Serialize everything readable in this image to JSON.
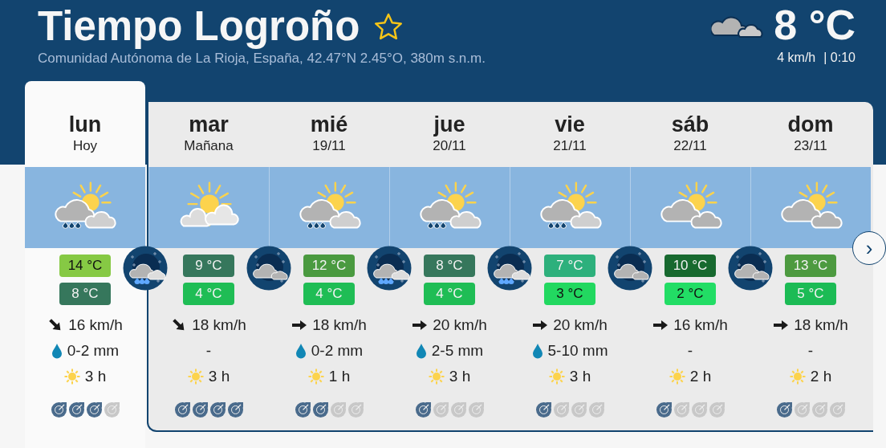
{
  "header": {
    "title": "Tiempo Logroño",
    "location": "Comunidad Autónoma de La Rioja, España, 42.47°N 2.45°O, 380m s.n.m."
  },
  "current": {
    "temperature": "8 °C",
    "wind": "4 km/h",
    "time": "| 0:10"
  },
  "days": [
    {
      "name": "lun",
      "date": "Hoy",
      "selected": true,
      "sky": {
        "kind": "rain"
      },
      "night": {
        "kind": "rain"
      },
      "max": {
        "text": "14 °C",
        "color": "#86c944"
      },
      "min": {
        "text": "8 °C",
        "color": "#36775c"
      },
      "wind": {
        "kind": "southeast",
        "text": "16 km/h"
      },
      "rain_icon": true,
      "rain": "0-2 mm",
      "sun": "3 h",
      "stars": 3
    },
    {
      "name": "mar",
      "date": "Mañana",
      "selected": false,
      "sky": {
        "kind": "sunny"
      },
      "night": {
        "kind": "cloud"
      },
      "max": {
        "text": "9 °C",
        "color": "#36775c"
      },
      "min": {
        "text": "4 °C",
        "color": "#1fbd55"
      },
      "wind": {
        "kind": "southeast",
        "text": "18 km/h"
      },
      "rain_icon": false,
      "rain": "-",
      "sun": "3 h",
      "stars": 4
    },
    {
      "name": "mié",
      "date": "19/11",
      "selected": false,
      "sky": {
        "kind": "rain"
      },
      "night": {
        "kind": "rain"
      },
      "max": {
        "text": "12 °C",
        "color": "#4a9a40"
      },
      "min": {
        "text": "4 °C",
        "color": "#1fbd55"
      },
      "wind": {
        "kind": "east",
        "text": "18 km/h"
      },
      "rain_icon": true,
      "rain": "0-2 mm",
      "sun": "1 h",
      "stars": 2
    },
    {
      "name": "jue",
      "date": "20/11",
      "selected": false,
      "sky": {
        "kind": "rain"
      },
      "night": {
        "kind": "rain"
      },
      "max": {
        "text": "8 °C",
        "color": "#36775c"
      },
      "min": {
        "text": "4 °C",
        "color": "#1fbd55"
      },
      "wind": {
        "kind": "east",
        "text": "20 km/h"
      },
      "rain_icon": true,
      "rain": "2-5 mm",
      "sun": "3 h",
      "stars": 1
    },
    {
      "name": "vie",
      "date": "21/11",
      "selected": false,
      "sky": {
        "kind": "rain"
      },
      "night": {
        "kind": "cloud"
      },
      "max": {
        "text": "7 °C",
        "color": "#2db07c"
      },
      "min": {
        "text": "3 °C",
        "color": "#22d860"
      },
      "wind": {
        "kind": "east",
        "text": "20 km/h"
      },
      "rain_icon": true,
      "rain": "5-10 mm",
      "sun": "3 h",
      "stars": 1
    },
    {
      "name": "sáb",
      "date": "22/11",
      "selected": false,
      "sky": {
        "kind": "cloud"
      },
      "night": {
        "kind": "cloud"
      },
      "max": {
        "text": "10 °C",
        "color": "#17692f"
      },
      "min": {
        "text": "2 °C",
        "color": "#22dd65"
      },
      "wind": {
        "kind": "east",
        "text": "16 km/h"
      },
      "rain_icon": false,
      "rain": "-",
      "sun": "2 h",
      "stars": 1
    },
    {
      "name": "dom",
      "date": "23/11",
      "selected": false,
      "sky": {
        "kind": "cloud"
      },
      "max": {
        "text": "13 °C",
        "color": "#4d9a40"
      },
      "min": {
        "text": "5 °C",
        "color": "#1cbb55"
      },
      "wind": {
        "kind": "east",
        "text": "18 km/h"
      },
      "rain_icon": false,
      "rain": "-",
      "sun": "2 h",
      "stars": 1
    }
  ],
  "next_button": "›"
}
